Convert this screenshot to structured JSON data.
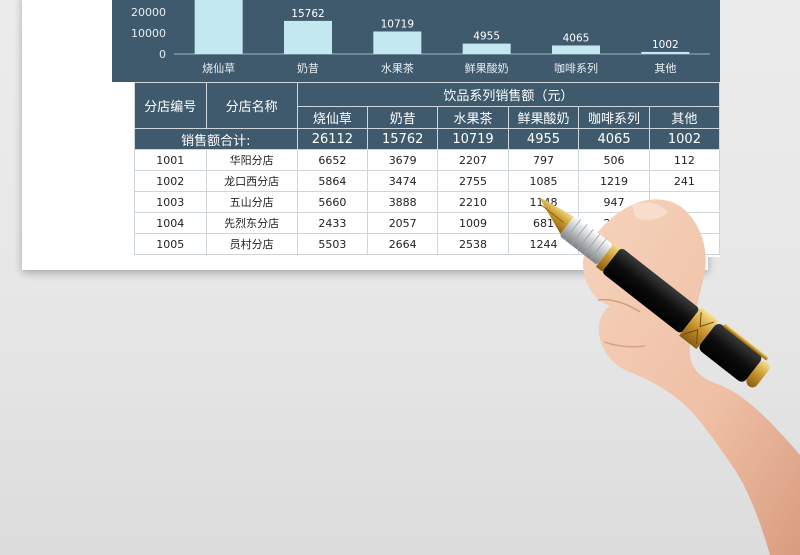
{
  "chart_data": {
    "type": "bar",
    "categories": [
      "烧仙草",
      "奶昔",
      "水果茶",
      "鲜果酸奶",
      "咖啡系列",
      "其他"
    ],
    "values": [
      26112,
      15762,
      10719,
      4955,
      4065,
      1002
    ],
    "value_labels": [
      "",
      "15762",
      "10719",
      "4955",
      "4065",
      "1002"
    ],
    "y_ticks": [
      "0",
      "10000",
      "20000"
    ],
    "ylim": [
      0,
      30000
    ],
    "colors": {
      "bar": "#c3e8f0",
      "background": "#3f5a6c",
      "text": "#ffffff"
    }
  },
  "table": {
    "col_store_id": "分店编号",
    "col_store_name": "分店名称",
    "group_header": "饮品系列销售额（元）",
    "categories": [
      "烧仙草",
      "奶昔",
      "水果茶",
      "鲜果酸奶",
      "咖啡系列",
      "其他"
    ],
    "total_label": "销售额合计:",
    "totals": [
      "26112",
      "15762",
      "10719",
      "4955",
      "4065",
      "1002"
    ],
    "rows": [
      {
        "id": "1001",
        "name": "华阳分店",
        "values": [
          "6652",
          "3679",
          "2207",
          "797",
          "506",
          "112"
        ]
      },
      {
        "id": "1002",
        "name": "龙口西分店",
        "values": [
          "5864",
          "3474",
          "2755",
          "1085",
          "1219",
          "241"
        ]
      },
      {
        "id": "1003",
        "name": "五山分店",
        "values": [
          "5660",
          "3888",
          "2210",
          "1148",
          "947",
          ""
        ]
      },
      {
        "id": "1004",
        "name": "先烈东分店",
        "values": [
          "2433",
          "2057",
          "1009",
          "681",
          "293",
          ""
        ]
      },
      {
        "id": "1005",
        "name": "员村分店",
        "values": [
          "5503",
          "2664",
          "2538",
          "1244",
          "",
          ""
        ]
      }
    ]
  }
}
